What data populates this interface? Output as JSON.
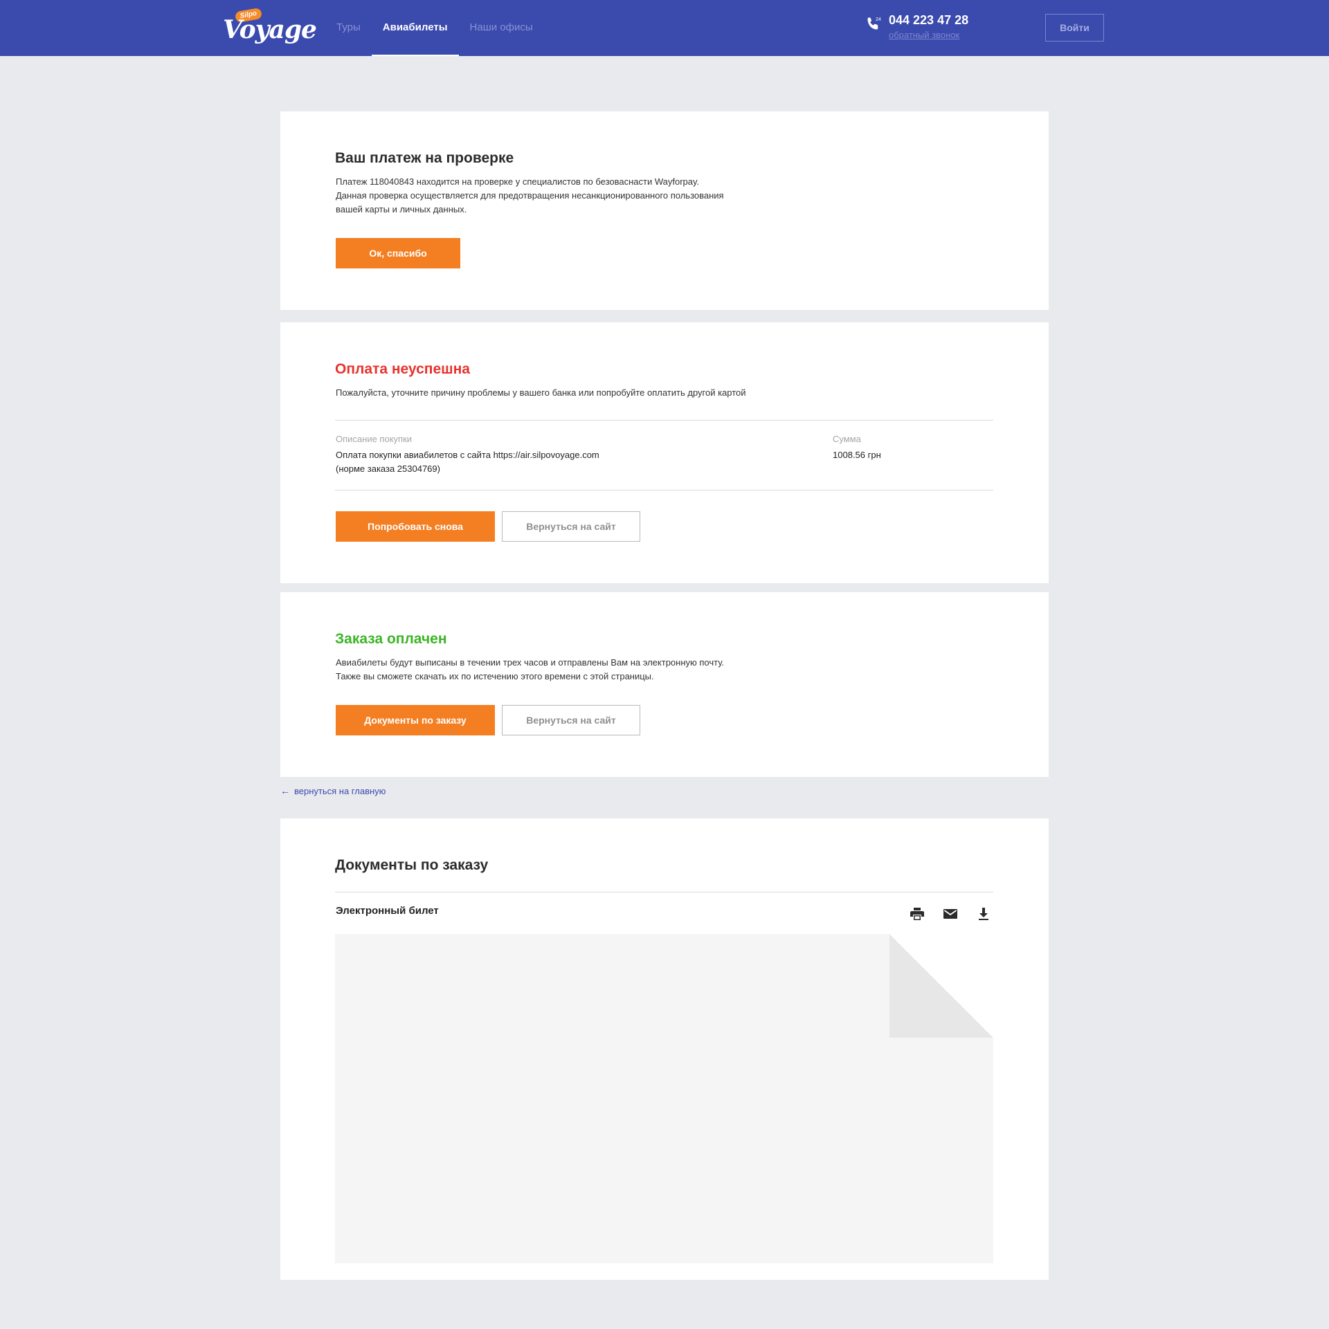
{
  "header": {
    "logo_text": "Voyage",
    "logo_badge": "Silpo",
    "nav": [
      {
        "label": "Туры"
      },
      {
        "label": "Авиабилеты"
      },
      {
        "label": "Наши офисы"
      }
    ],
    "phone_badge": "24",
    "phone": "044 223 47 28",
    "callback": "обратный звонок",
    "login": "Войти"
  },
  "colors": {
    "header_bg": "#3a4aad",
    "accent": "#f47f23",
    "error": "#e8332c",
    "success": "#3cb526",
    "page_bg": "#e9eaee"
  },
  "review": {
    "title": "Ваш платеж на проверке",
    "text_lines": [
      "Платеж 118040843 находится на проверке у специалистов по безоваснасти Wayforpay.",
      "Данная проверка осуществляется для предотвращения несанкционированного пользования",
      "вашей карты и личных данных."
    ],
    "ok_button": "Ок, спасибо"
  },
  "failed": {
    "title": "Оплата неуспешна",
    "text": "Пожалуйста, уточните причину проблемы у вашего банка или попробуйте оплатить другой картой",
    "desc_label": "Описание покупки",
    "desc_lines": [
      "Оплата покупки авиабилетов с сайта https://air.silpovoyage.com",
      "(норме заказа 25304769)"
    ],
    "sum_label": "Сумма",
    "sum_value": "1008.56 грн",
    "retry_button": "Попробовать снова",
    "back_button": "Вернуться на сайт"
  },
  "paid": {
    "title": "Заказа оплачен",
    "text_lines": [
      "Авиабилеты будут выписаны в течении трех часов и отправлены Вам на электронную почту.",
      "Также вы сможете скачать их по истечению этого времени с этой страницы."
    ],
    "docs_button": "Документы по заказу",
    "back_button": "Вернуться на сайт"
  },
  "back_link": "вернуться на главную",
  "documents": {
    "title": "Документы по заказу",
    "ticket_label": "Электронный билет",
    "icons": [
      "print-icon",
      "mail-icon",
      "download-icon"
    ]
  }
}
